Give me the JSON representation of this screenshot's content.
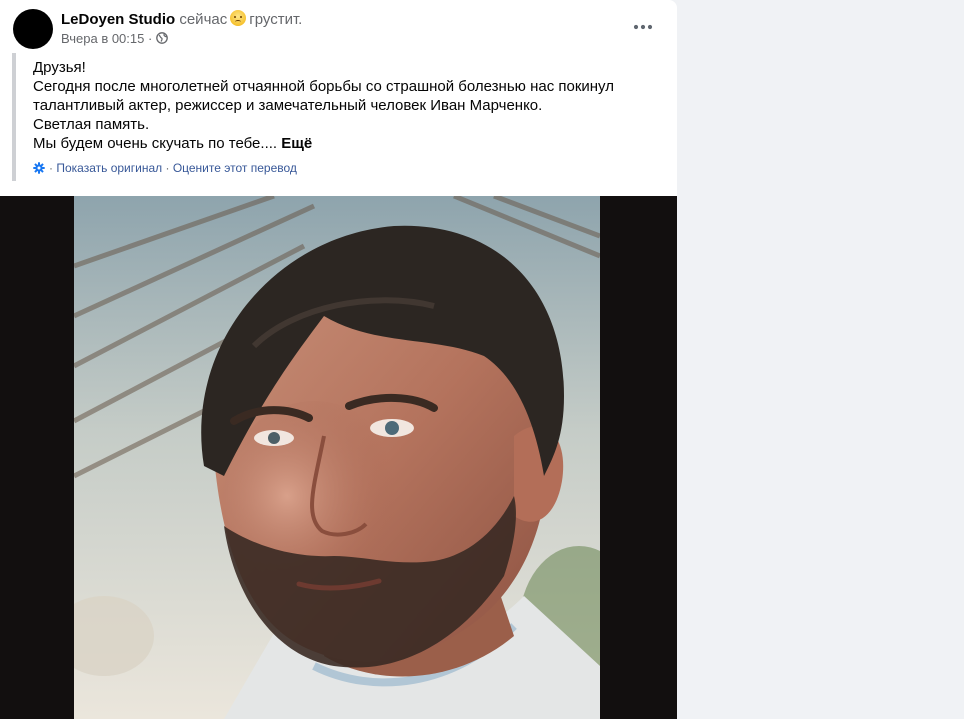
{
  "post": {
    "author": "LeDoyen Studio",
    "feeling_prefix": "сейчас",
    "feeling": "грустит.",
    "feeling_icon": "sad-face-emoji",
    "timestamp": "Вчера в 00:15",
    "separator": "·",
    "privacy_icon": "globe-icon",
    "text_lines": [
      "Друзья!",
      "Сегодня после многолетней отчаянной борьбы со страшной болезнью нас покинул",
      "талантливый актер, режиссер и замечательный человек Иван Марченко.",
      "Светлая память.",
      "Мы будем очень скучать по тебе...."
    ],
    "see_more": "Ещё",
    "translation": {
      "show_original": "Показать оригинал",
      "separator": "·",
      "rate_translation": "Оцените этот перевод"
    }
  },
  "colors": {
    "page_background": "#f0f2f5",
    "card_background": "#ffffff",
    "media_background": "#120f0f",
    "link_blue": "#385898",
    "secondary_text": "#65676b"
  }
}
